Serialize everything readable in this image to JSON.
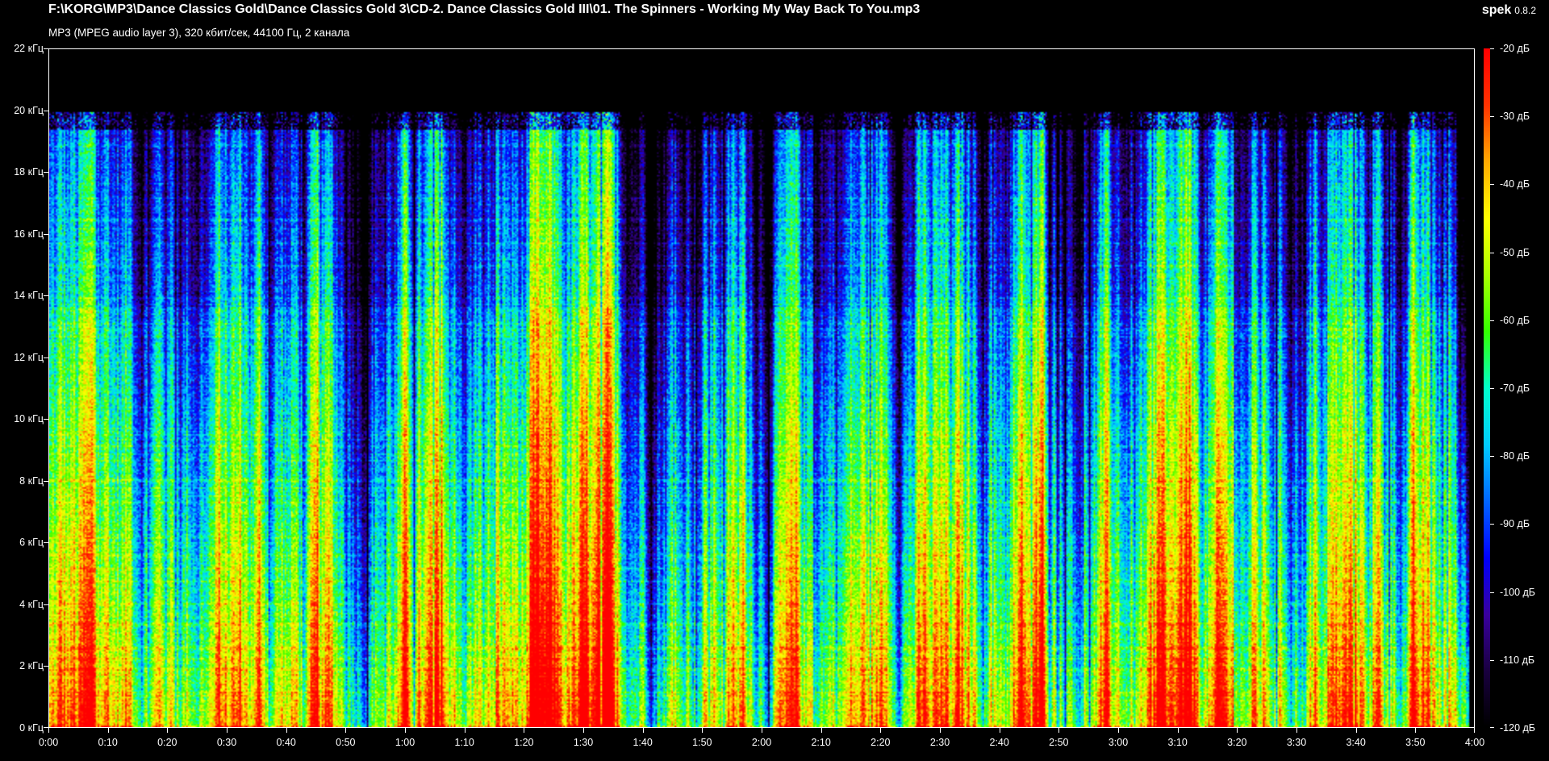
{
  "window": {
    "title": "F:\\KORG\\MP3\\Dance Classics Gold\\Dance Classics Gold 3\\CD-2. Dance Classics Gold III\\01. The Spinners - Working My Way Back To You.mp3",
    "subtitle": "MP3 (MPEG audio layer 3), 320 кбит/сек, 44100 Гц, 2 канала",
    "app_name": "spek",
    "app_version": "0.8.2"
  },
  "chart_data": {
    "type": "heatmap",
    "y_ticks": [
      "0 кГц",
      "2 кГц",
      "4 кГц",
      "6 кГц",
      "8 кГц",
      "10 кГц",
      "12 кГц",
      "14 кГц",
      "16 кГц",
      "18 кГц",
      "20 кГц",
      "22 кГц"
    ],
    "y_values_khz": [
      0,
      2,
      4,
      6,
      8,
      10,
      12,
      14,
      16,
      18,
      20,
      22
    ],
    "ylim": [
      0,
      22
    ],
    "x_ticks": [
      "0:00",
      "0:10",
      "0:20",
      "0:30",
      "0:40",
      "0:50",
      "1:00",
      "1:10",
      "1:20",
      "1:30",
      "1:40",
      "1:50",
      "2:00",
      "2:10",
      "2:20",
      "2:30",
      "2:40",
      "2:50",
      "3:00",
      "3:10",
      "3:20",
      "3:30",
      "3:40",
      "3:50",
      "4:00"
    ],
    "x_values_s": [
      0,
      10,
      20,
      30,
      40,
      50,
      60,
      70,
      80,
      90,
      100,
      110,
      120,
      130,
      140,
      150,
      160,
      170,
      180,
      190,
      200,
      210,
      220,
      230,
      240
    ],
    "xlim": [
      0,
      240
    ],
    "duration_s": 239,
    "cutoff_khz": 20,
    "colorbar_ticks": [
      "-20 дБ",
      "-30 дБ",
      "-40 дБ",
      "-50 дБ",
      "-60 дБ",
      "-70 дБ",
      "-80 дБ",
      "-90 дБ",
      "-100 дБ",
      "-110 дБ",
      "-120 дБ"
    ],
    "colorbar_values_db": [
      -20,
      -30,
      -40,
      -50,
      -60,
      -70,
      -80,
      -90,
      -100,
      -110,
      -120
    ],
    "color_range_db": [
      -120,
      -20
    ],
    "colormap": [
      "#000000",
      "#1a0040",
      "#3a00a0",
      "#0000ff",
      "#0066ff",
      "#00ccff",
      "#00ffcc",
      "#33ff00",
      "#aaff00",
      "#ffff00",
      "#ffaa00",
      "#ff3300",
      "#ff0000"
    ]
  }
}
